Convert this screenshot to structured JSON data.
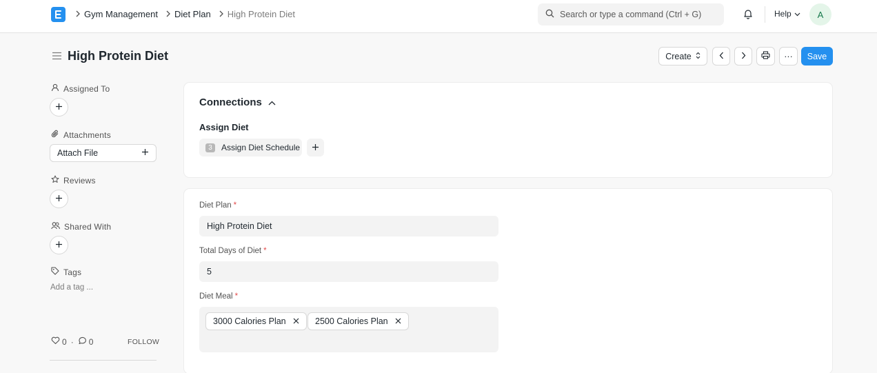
{
  "navbar": {
    "logo_letter": "E",
    "breadcrumbs": [
      "Gym Management",
      "Diet Plan",
      "High Protein Diet"
    ],
    "search_placeholder": "Search or type a command (Ctrl + G)",
    "help_label": "Help",
    "avatar_initial": "A"
  },
  "page": {
    "title": "High Protein Diet",
    "actions": {
      "create_label": "Create",
      "more_label": "···",
      "save_label": "Save"
    }
  },
  "sidebar": {
    "assigned_to": "Assigned To",
    "attachments": "Attachments",
    "attach_file": "Attach File",
    "reviews": "Reviews",
    "shared_with": "Shared With",
    "tags": "Tags",
    "add_tag": "Add a tag ...",
    "likes": "0",
    "comments": "0",
    "follow": "FOLLOW"
  },
  "connections": {
    "title": "Connections",
    "group_label": "Assign Diet",
    "link_count": "3",
    "link_label": "Assign Diet Schedule"
  },
  "form": {
    "diet_plan": {
      "label": "Diet Plan",
      "value": "High Protein Diet"
    },
    "total_days": {
      "label": "Total Days of Diet",
      "value": "5"
    },
    "diet_meal": {
      "label": "Diet Meal",
      "chips": [
        "3000 Calories Plan",
        "2500 Calories Plan"
      ]
    }
  },
  "colors": {
    "primary": "#2490ef",
    "required": "#e24c4c",
    "avatar_bg": "#e4f5e9",
    "avatar_fg": "#16794c"
  }
}
